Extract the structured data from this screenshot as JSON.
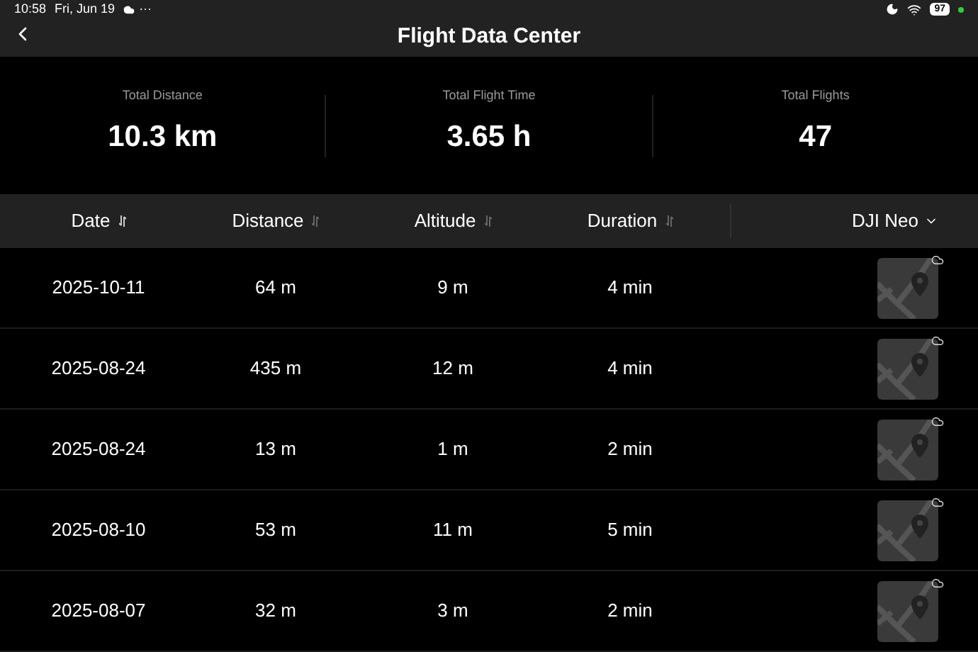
{
  "status_bar": {
    "time": "10:58",
    "date": "Fri, Jun 19",
    "more": "···",
    "battery": "97"
  },
  "header": {
    "title": "Flight Data Center"
  },
  "stats": [
    {
      "label": "Total Distance",
      "value": "10.3 km"
    },
    {
      "label": "Total Flight Time",
      "value": "3.65 h"
    },
    {
      "label": "Total Flights",
      "value": "47"
    }
  ],
  "table": {
    "columns": [
      {
        "label": "Date",
        "selected": true
      },
      {
        "label": "Distance",
        "selected": false
      },
      {
        "label": "Altitude",
        "selected": false
      },
      {
        "label": "Duration",
        "selected": false
      }
    ],
    "device_filter": "DJI Neo",
    "rows": [
      {
        "date": "2025-10-11",
        "distance": "64 m",
        "altitude": "9 m",
        "duration": "4 min"
      },
      {
        "date": "2025-08-24",
        "distance": "435 m",
        "altitude": "12 m",
        "duration": "4 min"
      },
      {
        "date": "2025-08-24",
        "distance": "13 m",
        "altitude": "1 m",
        "duration": "2 min"
      },
      {
        "date": "2025-08-10",
        "distance": "53 m",
        "altitude": "11 m",
        "duration": "5 min"
      },
      {
        "date": "2025-08-07",
        "distance": "32 m",
        "altitude": "3 m",
        "duration": "2 min"
      }
    ]
  }
}
